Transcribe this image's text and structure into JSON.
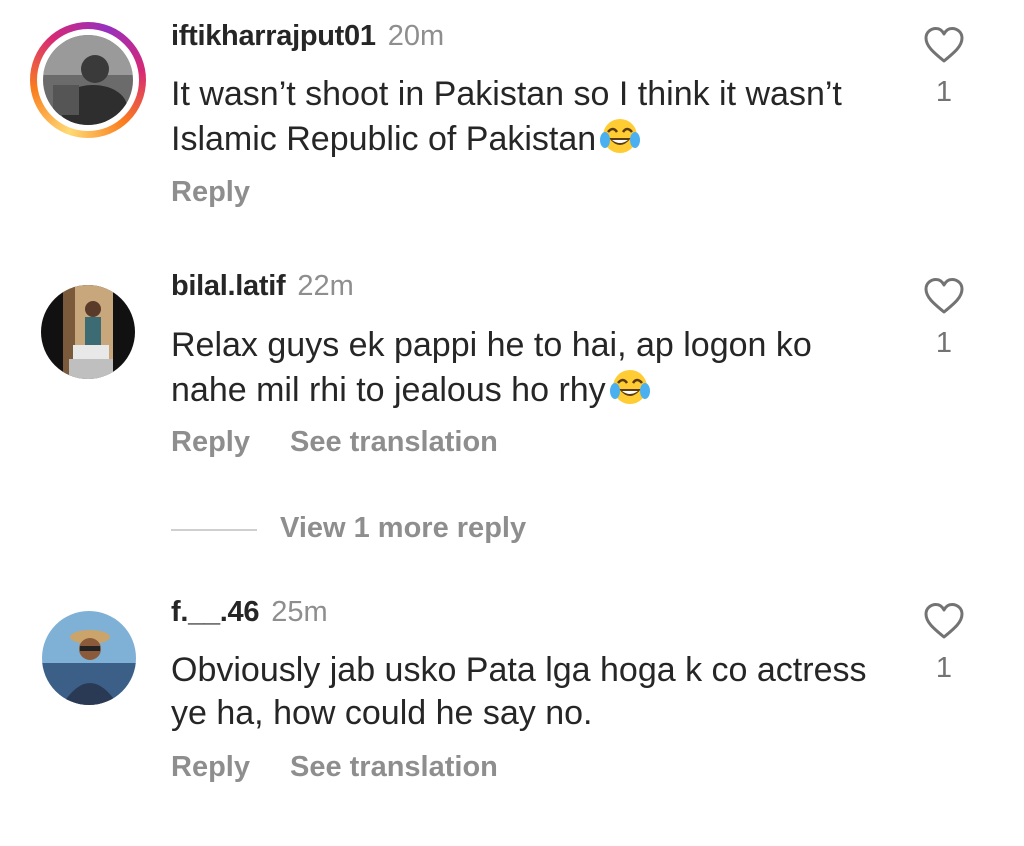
{
  "comments": [
    {
      "username": "iftikharrajput01",
      "time": "20m",
      "text": "It wasn’t shoot in Pakistan so I think it wasn’t Islamic Republic of Pakistan",
      "emoji": "face-with-tears-of-joy",
      "reply_label": "Reply",
      "translation_label": "",
      "likes": "1",
      "has_story": true
    },
    {
      "username": "bilal.latif",
      "time": "22m",
      "text": "Relax guys ek pappi he to hai, ap logon ko nahe mil rhi to jealous ho rhy",
      "emoji": "face-with-tears-of-joy",
      "reply_label": "Reply",
      "translation_label": "See translation",
      "likes": "1",
      "has_story": false
    },
    {
      "username": "f.__.46",
      "time": "25m",
      "text": "Obviously jab usko Pata lga hoga k co actress ye ha, how could he say no.",
      "emoji": "",
      "reply_label": "Reply",
      "translation_label": "See translation",
      "likes": "1",
      "has_story": false
    }
  ],
  "more_replies_label": "View 1 more reply",
  "icons": {
    "like": "heart-outline-icon",
    "emoji": "face-with-tears-of-joy"
  },
  "colors": {
    "text": "#262626",
    "secondary": "#8e8e8e",
    "story_ring": [
      "#feda75",
      "#fa7e1e",
      "#d62976",
      "#962fbf"
    ]
  }
}
